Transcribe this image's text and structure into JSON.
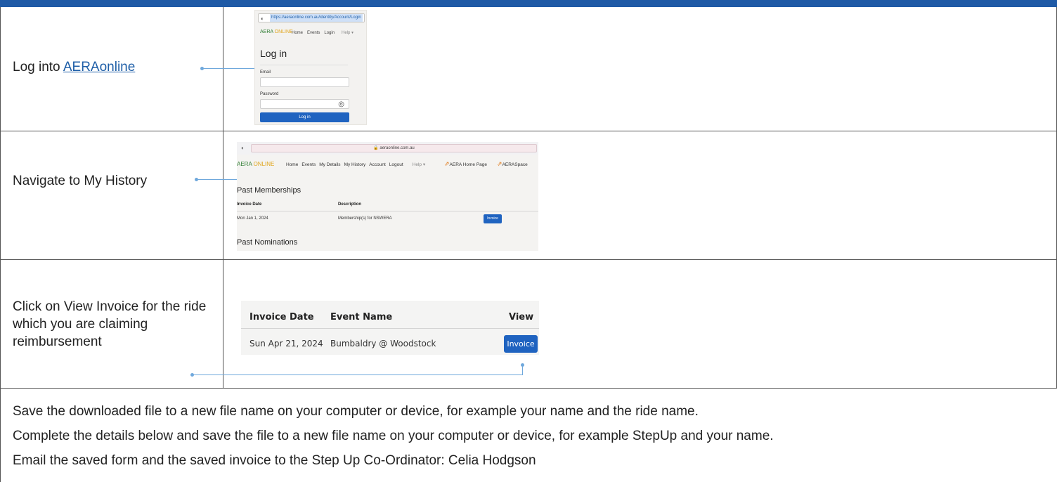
{
  "steps": [
    {
      "text_prefix": "Log into ",
      "link": "AERAonline"
    },
    {
      "text": "Navigate to My History"
    },
    {
      "text": "Click on View Invoice for the ride which you are claiming reimbursement"
    }
  ],
  "login_shot": {
    "url": "https://aeraonline.com.au/identity/Account/Login",
    "brand_a": "AERA",
    "brand_b": "ONLINE",
    "nav": [
      "Home",
      "Events",
      "Login",
      "Help ▾"
    ],
    "title": "Log in",
    "email_label": "Email",
    "password_label": "Password",
    "button": "Log in"
  },
  "history_shot": {
    "url": "aeraonline.com.au",
    "brand_a": "AERA",
    "brand_b": "ONLINE",
    "nav": [
      "Home",
      "Events",
      "My Details",
      "My History",
      "Account",
      "Logout"
    ],
    "help": "Help ▾",
    "ext_links": [
      "AERA Home Page",
      "AERASpace"
    ],
    "section_memberships": "Past Memberships",
    "col_invoice_date": "Invoice Date",
    "col_description": "Description",
    "row_date": "Mon Jan 1, 2024",
    "row_description": "Membership(s) for NSWERA",
    "row_button": "Invoice",
    "section_nominations": "Past Nominations"
  },
  "invoice_shot": {
    "col_invoice_date": "Invoice Date",
    "col_event_name": "Event Name",
    "col_view": "View",
    "row_date": "Sun Apr 21, 2024",
    "row_event": "Bumbaldry @ Woodstock",
    "row_button": "Invoice"
  },
  "instructions": [
    "Save the downloaded file to a new file name on your computer or device, for example your name and the ride name.",
    "Complete the details below and save the file to a new file name on your computer or device, for example StepUp and your name.",
    "Email the saved form and the saved invoice to the Step Up Co-Ordinator: Celia Hodgson"
  ],
  "colors": {
    "header": "#1f5aa6",
    "connector": "#6fa8dc",
    "button": "#1f63c0",
    "link": "#1f5fa8"
  }
}
